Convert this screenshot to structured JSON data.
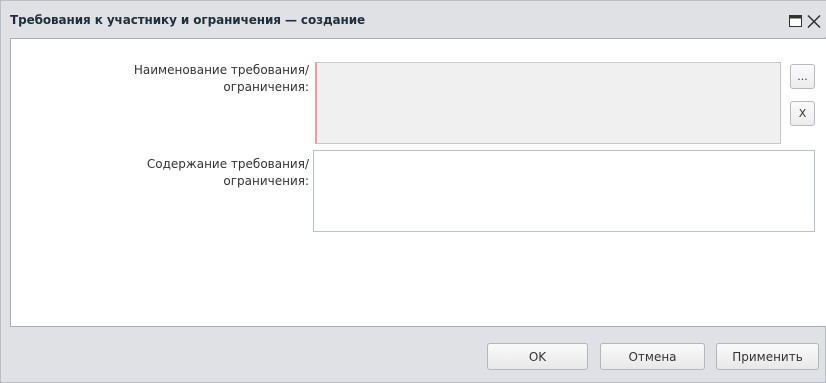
{
  "window": {
    "title": "Требования к участнику и ограничения — создание"
  },
  "form": {
    "name_label_line1": "Наименование требования/",
    "name_label_line2": "ограничения:",
    "name_value": "",
    "select_button": "...",
    "clear_button": "X",
    "content_label_line1": "Содержание требования/",
    "content_label_line2": "ограничения:",
    "content_value": ""
  },
  "footer": {
    "ok_label": "OK",
    "cancel_label": "Отмена",
    "apply_label": "Применить"
  },
  "colors": {
    "required_marker": "#f19c9c",
    "dialog_bg": "#dfe1e5"
  },
  "icons": {
    "maximize": "maximize-icon",
    "close": "close-icon"
  }
}
